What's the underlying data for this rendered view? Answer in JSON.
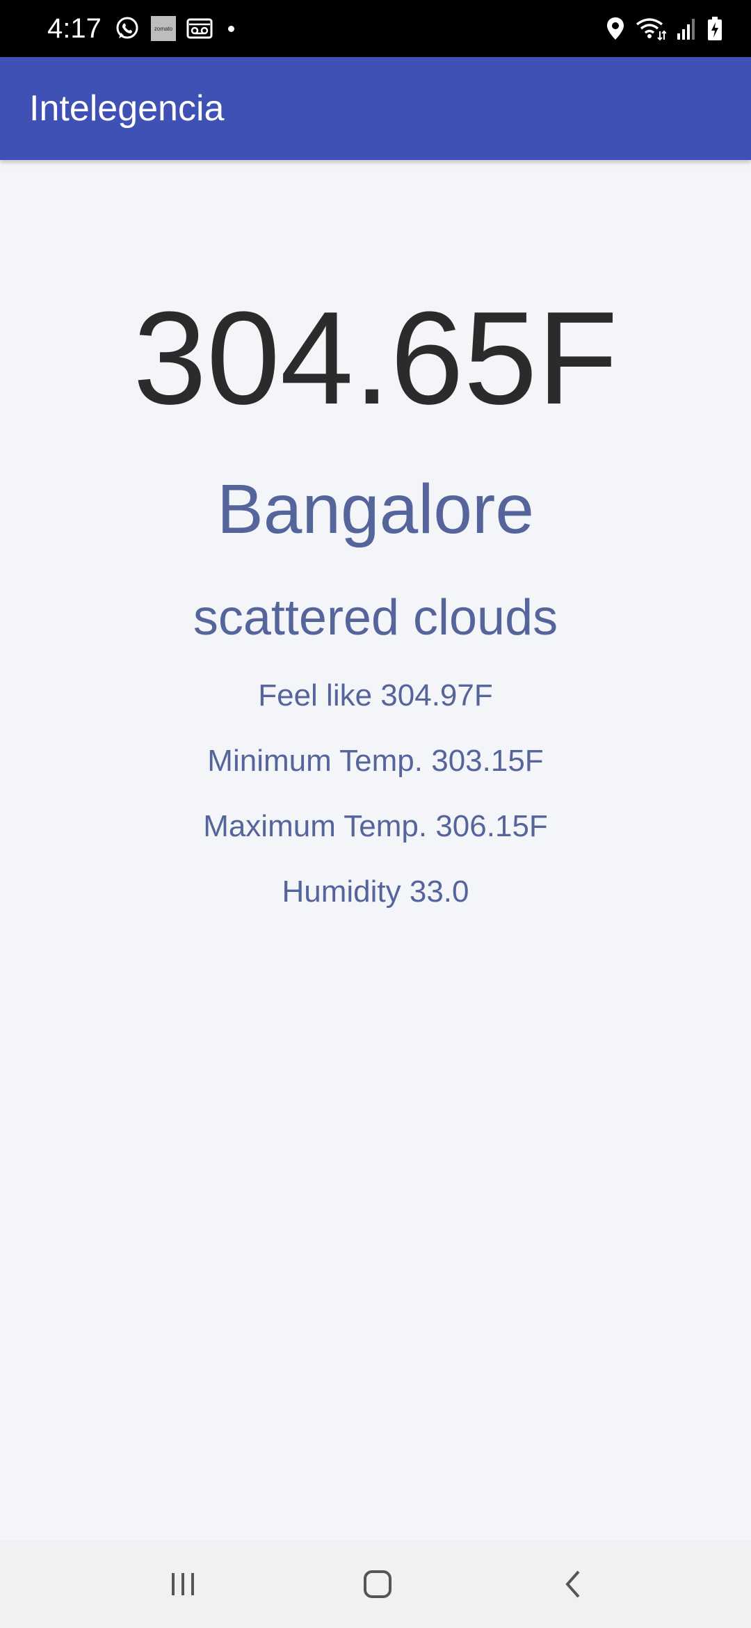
{
  "status_bar": {
    "time": "4:17",
    "left_icons": [
      "whatsapp-icon",
      "zomato-icon",
      "voicemail-icon",
      "notification-dot-icon"
    ],
    "right_icons": [
      "location-icon",
      "wifi-icon",
      "signal-icon",
      "battery-charging-icon"
    ],
    "zomato_text": "zomato"
  },
  "app_bar": {
    "title": "Intelegencia",
    "color": "#3f51b5"
  },
  "weather": {
    "temperature": "304.65F",
    "city": "Bangalore",
    "description": "scattered clouds",
    "feels_like": "Feel like 304.97F",
    "min_temp": "Minimum Temp. 303.15F",
    "max_temp": "Maximum Temp. 306.15F",
    "humidity": "Humidity 33.0"
  },
  "colors": {
    "background": "#f4f5f8",
    "temperature_text": "#2b2b2b",
    "secondary_text": "#55659c"
  },
  "nav_bar": {
    "buttons": [
      "recent-apps-icon",
      "home-icon",
      "back-icon"
    ]
  }
}
